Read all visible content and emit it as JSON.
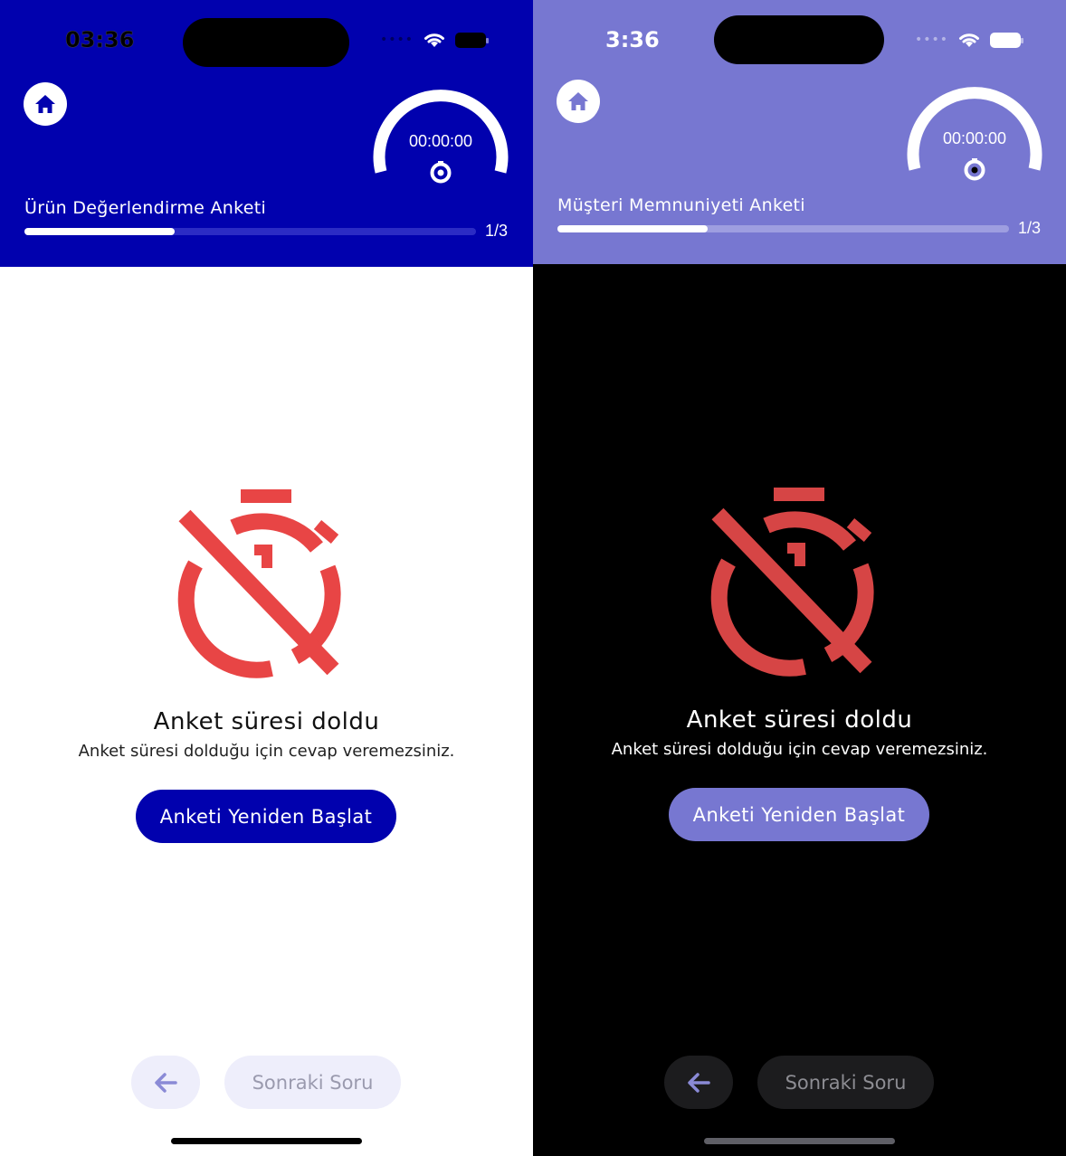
{
  "screens": {
    "light": {
      "status": {
        "time": "03:36",
        "signal": "••••"
      },
      "header": {
        "timer": "00:00:00",
        "survey_title": "Ürün Değerlendirme Anketi",
        "progress_count": "1/3",
        "progress_fraction": 0.333
      },
      "message": {
        "title": "Anket süresi doldu",
        "subtitle": "Anket süresi dolduğu için cevap veremezsiniz."
      },
      "buttons": {
        "restart": "Anketi Yeniden Başlat",
        "next": "Sonraki Soru"
      }
    },
    "dark": {
      "status": {
        "time": "3:36",
        "signal": "••••"
      },
      "header": {
        "timer": "00:00:00",
        "survey_title": "Müşteri Memnuniyeti Anketi",
        "progress_count": "1/3",
        "progress_fraction": 0.333
      },
      "message": {
        "title": "Anket süresi doldu",
        "subtitle": "Anket süresi dolduğu için cevap veremezsiniz."
      },
      "buttons": {
        "restart": "Anketi Yeniden Başlat",
        "next": "Sonraki Soru"
      }
    }
  },
  "colors": {
    "light_primary": "#0101AE",
    "dark_primary": "#7777D1",
    "expired_icon": "#E84545",
    "expired_icon_dark": "#D64545"
  },
  "icons": {
    "home": "home-icon",
    "timer": "target-icon",
    "expired": "timer-off-icon",
    "back": "arrow-left-icon",
    "wifi": "wifi-icon",
    "battery": "battery-icon"
  }
}
